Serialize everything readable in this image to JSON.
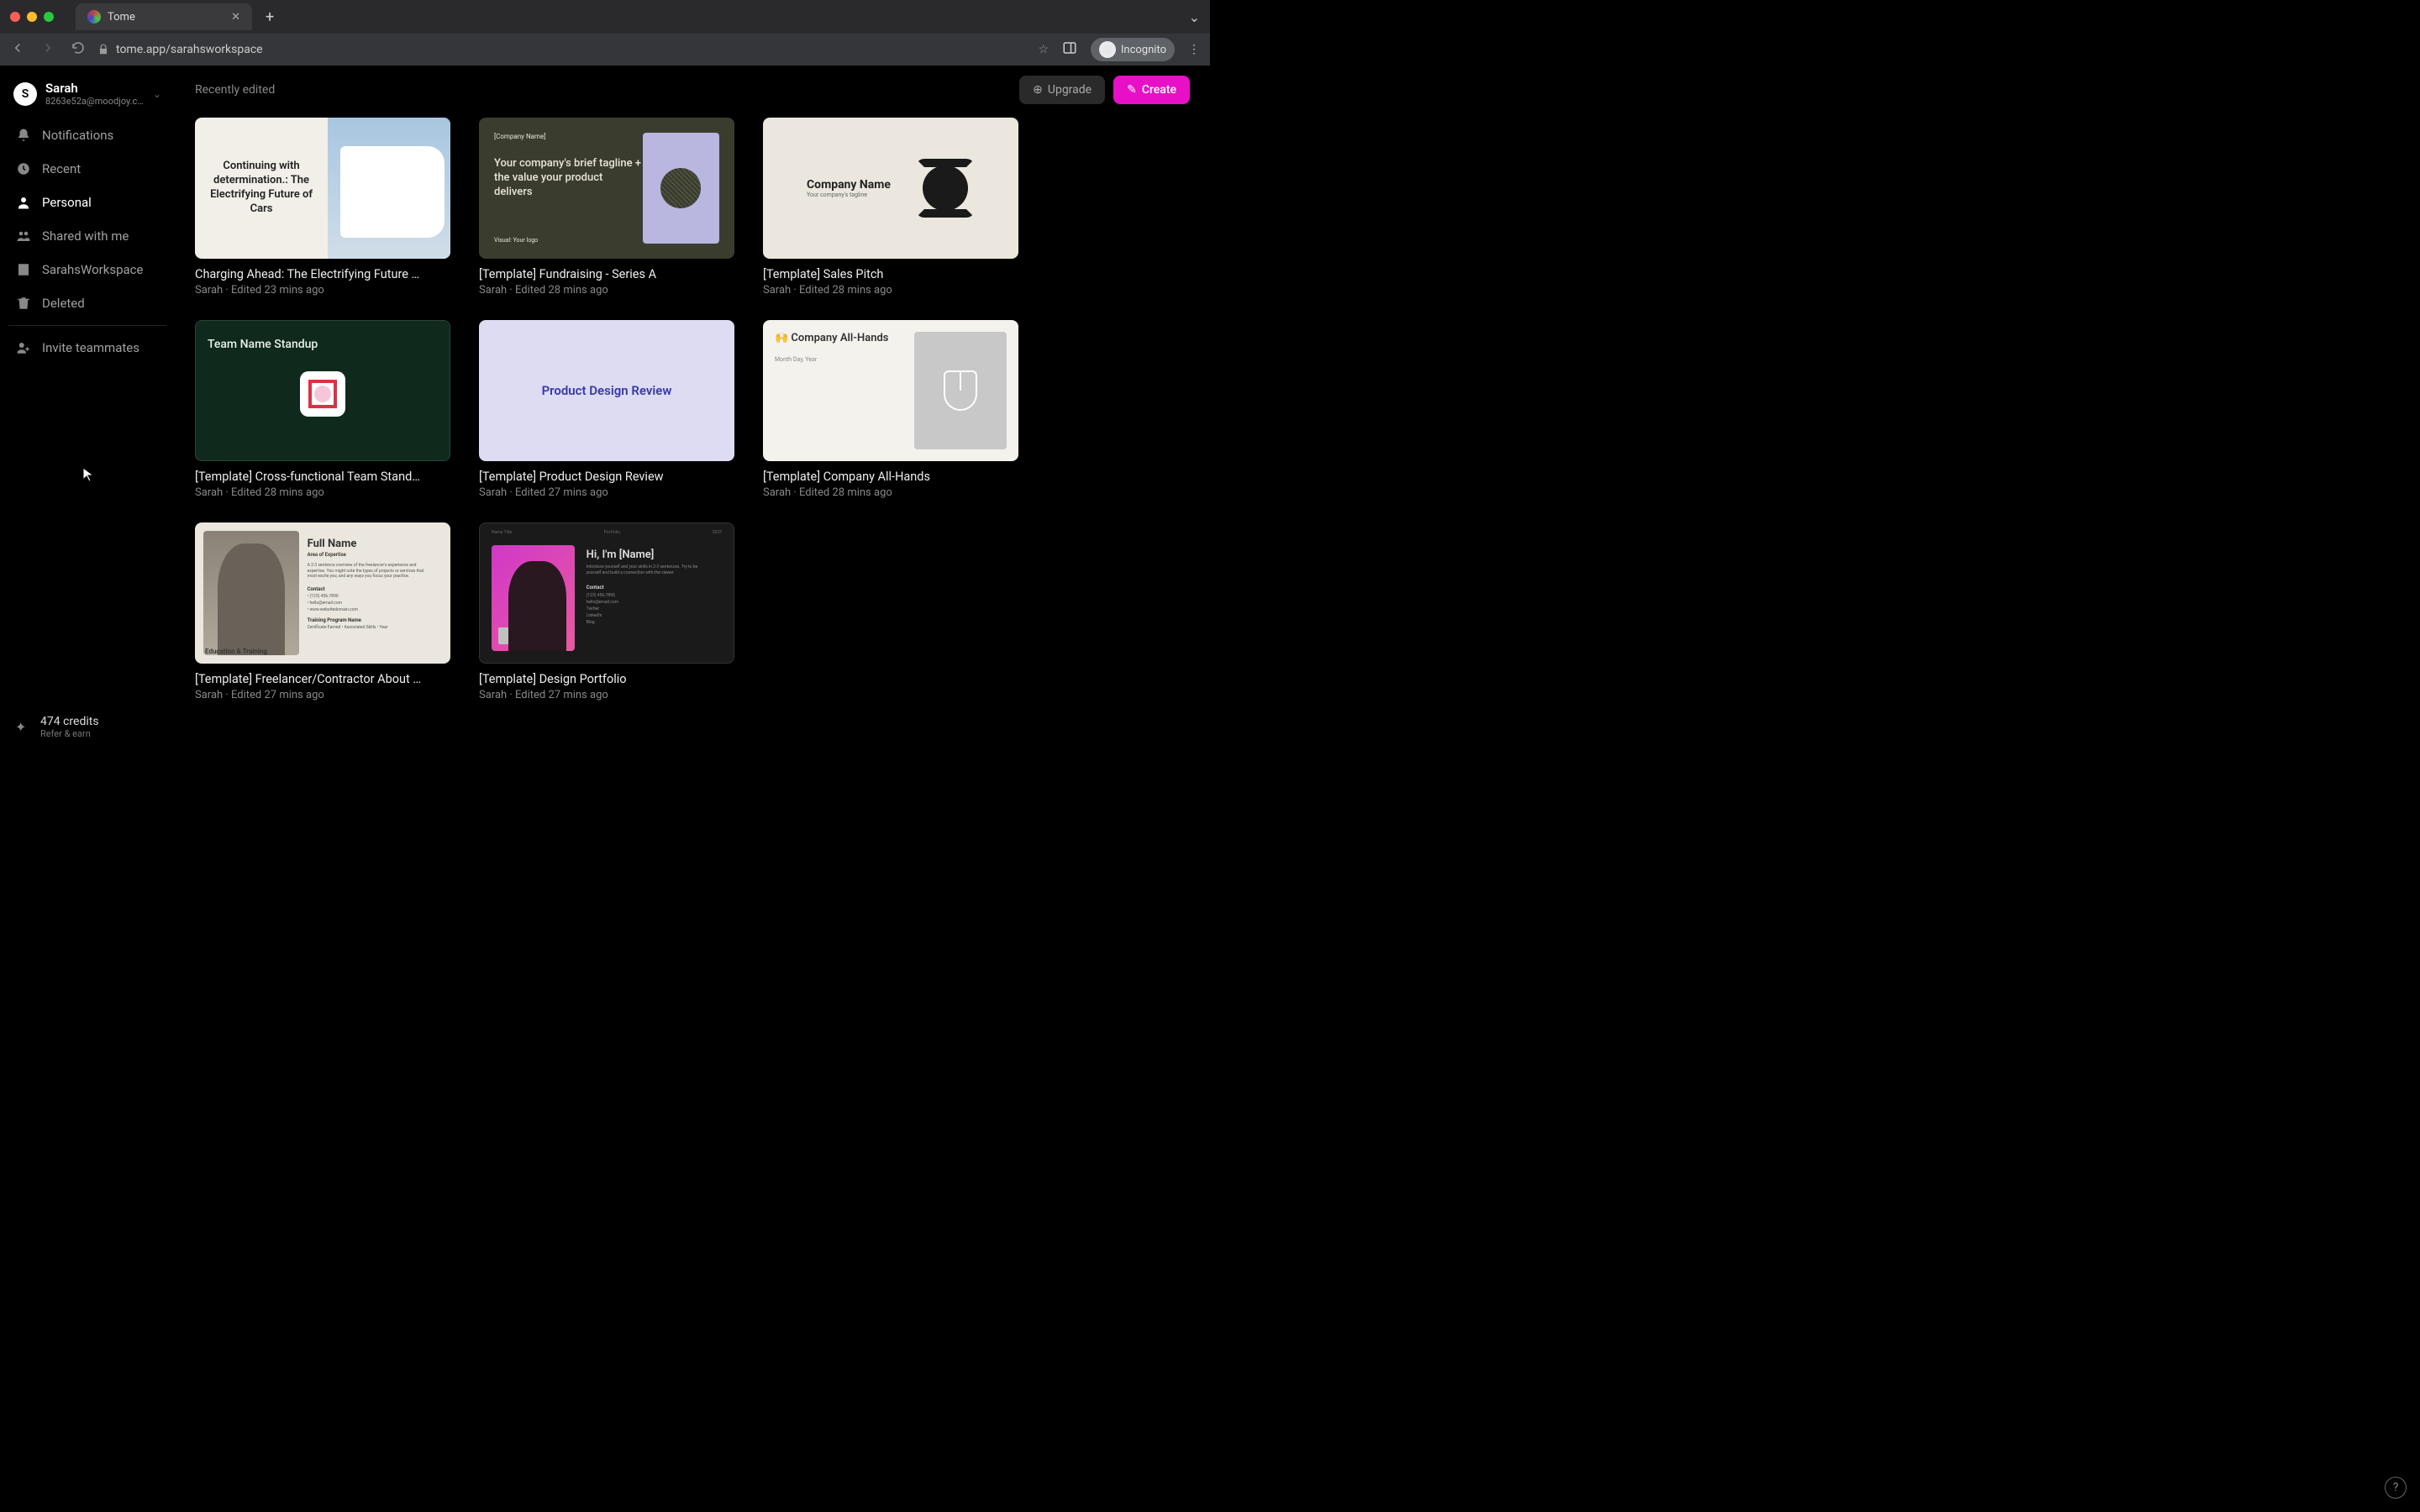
{
  "browser": {
    "tab_title": "Tome",
    "url": "tome.app/sarahsworkspace",
    "incognito_label": "Incognito"
  },
  "user": {
    "initial": "S",
    "name": "Sarah",
    "email": "8263e52a@moodjoy.c…"
  },
  "nav": {
    "notifications": "Notifications",
    "recent": "Recent",
    "personal": "Personal",
    "shared": "Shared with me",
    "workspace": "SarahsWorkspace",
    "deleted": "Deleted",
    "invite": "Invite teammates"
  },
  "credits": {
    "main": "474 credits",
    "sub": "Refer & earn"
  },
  "header": {
    "section": "Recently edited",
    "upgrade": "Upgrade",
    "create": "Create"
  },
  "cards": [
    {
      "title": "Charging Ahead: The Electrifying Future …",
      "meta": "Sarah · Edited 23 mins ago",
      "thumb": {
        "headline": "Continuing with determination.: The Electrifying Future of Cars"
      }
    },
    {
      "title": "[Template] Fundraising - Series A",
      "meta": "Sarah · Edited 28 mins ago",
      "thumb": {
        "company": "[Company Name]",
        "tagline": "Your company's brief tagline + the value your product delivers",
        "visual": "Visual: Your logo"
      }
    },
    {
      "title": "[Template] Sales Pitch",
      "meta": "Sarah · Edited 28 mins ago",
      "thumb": {
        "company": "Company Name",
        "tagline": "Your company's tagline"
      }
    },
    {
      "title": "[Template] Cross-functional Team Stand…",
      "meta": "Sarah · Edited 28 mins ago",
      "thumb": {
        "team": "Team Name Standup"
      }
    },
    {
      "title": "[Template] Product Design Review",
      "meta": "Sarah · Edited 27 mins ago",
      "thumb": {
        "title": "Product Design Review"
      }
    },
    {
      "title": "[Template] Company All-Hands",
      "meta": "Sarah · Edited 28 mins ago",
      "thumb": {
        "title": "Company All-Hands",
        "date": "Month Day, Year"
      }
    },
    {
      "title": "[Template] Freelancer/Contractor About …",
      "meta": "Sarah · Edited 27 mins ago",
      "thumb": {
        "name": "Full Name",
        "area": "Area of Expertise",
        "body": "A 2-3 sentence overview of the freelancer's experience and expertise. You might note the types of projects or services that most excite you, and any ways you focus your practice.",
        "contact": "Contact",
        "phone": "• (123) 456-7890",
        "email": "• hello@email.com",
        "site": "• www.websitedomain.com",
        "edu": "Education & Training",
        "prog": "Training Program Name",
        "cert": "Certificate Earned • Associated Skills • Year"
      }
    },
    {
      "title": "[Template] Design Portfolio",
      "meta": "Sarah · Edited 27 mins ago",
      "thumb": {
        "hi": "Hi, I'm [Name]",
        "intro": "Introduce yourself and your skills in 2-3 sentences. Try to be yourself and build a connection with the viewer.",
        "contact": "Contact",
        "phone": "(123) 456-7890",
        "email": "hello@email.com",
        "twitter": "Twitter",
        "linkedin": "LinkedIn",
        "blog": "Blog"
      }
    }
  ]
}
